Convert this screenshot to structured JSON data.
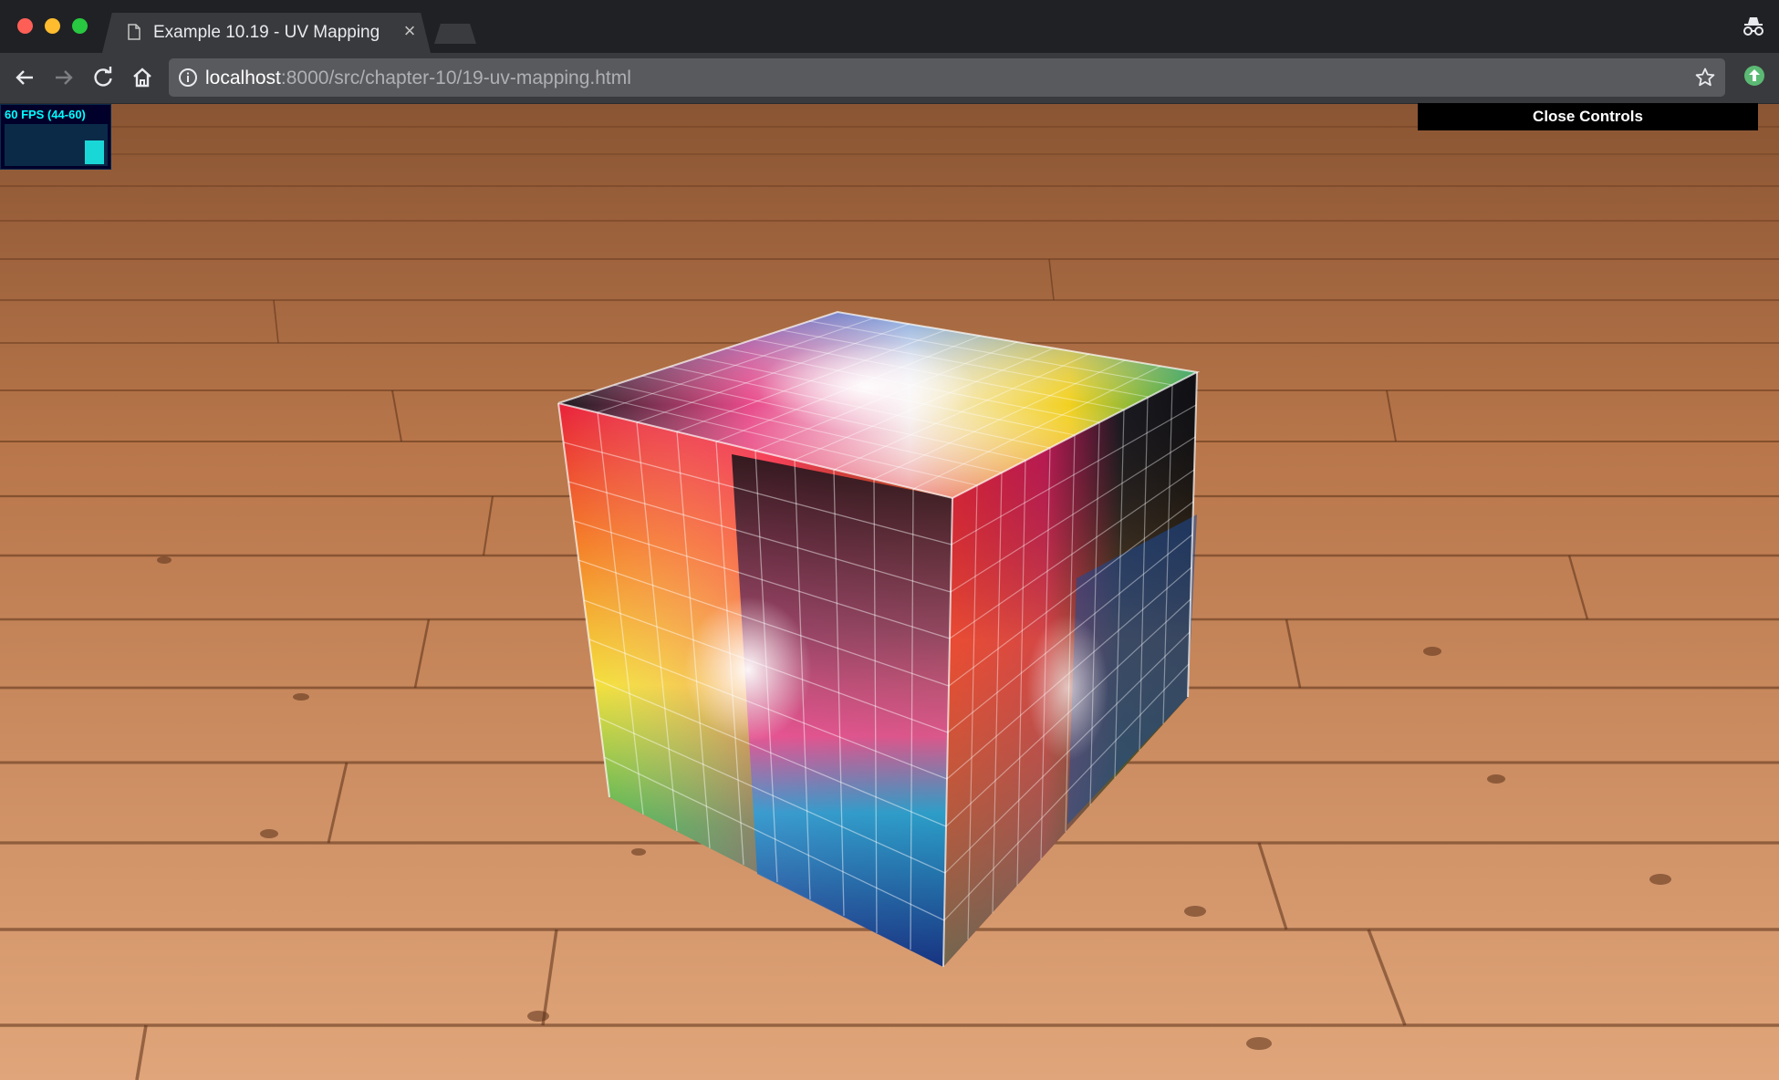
{
  "browser": {
    "tab_title": "Example 10.19 - UV Mapping",
    "url_host": "localhost",
    "url_path": ":8000/src/chapter-10/19-uv-mapping.html"
  },
  "stats": {
    "fps_label": "60 FPS (44-60)",
    "fps_level": 0.6
  },
  "controls": {
    "close_label": "Close Controls"
  },
  "colors": {
    "floor": "#c07a48",
    "accent_cyan": "#1ad7d7"
  }
}
